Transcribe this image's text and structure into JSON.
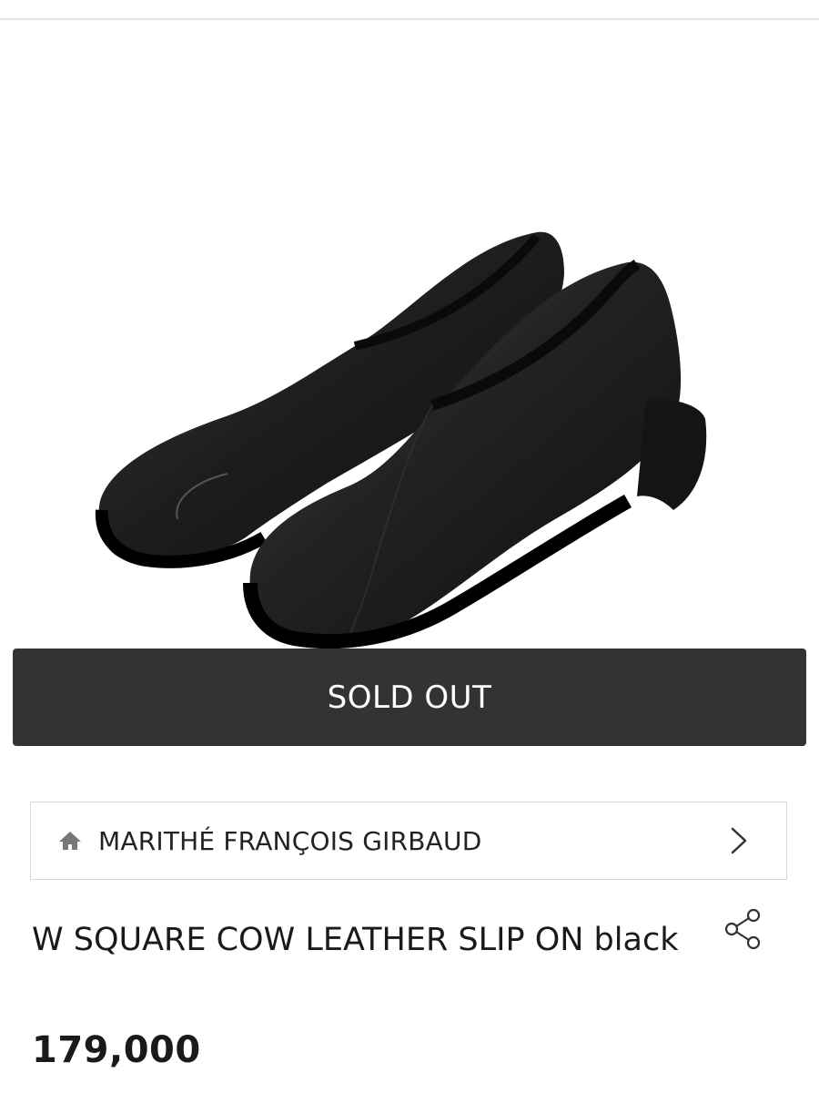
{
  "product": {
    "image_alt": "black square-toe leather slip-on shoes",
    "status_button": "SOLD OUT",
    "brand": {
      "icon": "home-icon",
      "name": "MARITHÉ FRANÇOIS GIRBAUD",
      "chevron": "chevron-right-icon"
    },
    "title": "W SQUARE COW LEATHER SLIP ON black",
    "share_icon": "share-icon",
    "price": "179,000"
  },
  "colors": {
    "button_bg": "#333333",
    "button_text": "#ffffff",
    "border": "#d9d9d9",
    "text": "#1a1a1a"
  }
}
